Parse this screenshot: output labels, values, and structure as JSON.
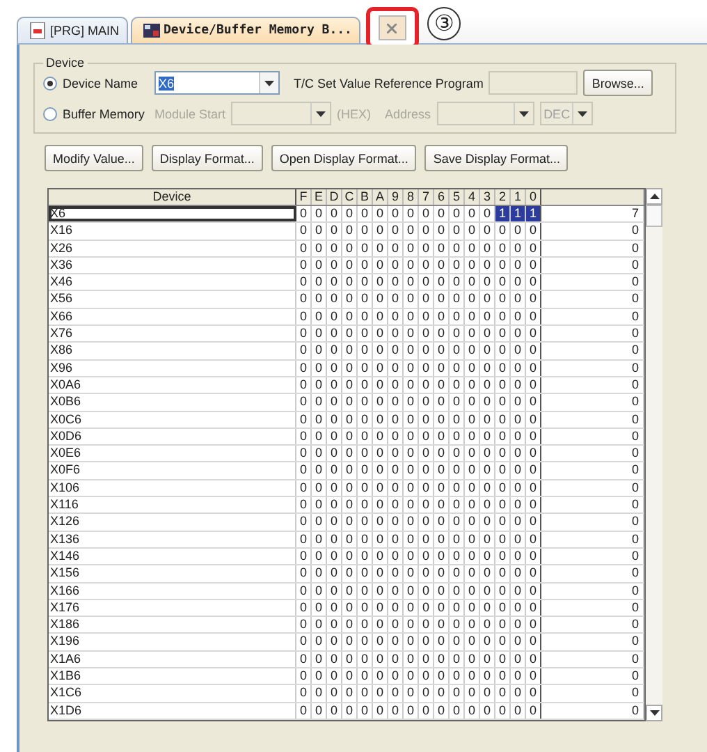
{
  "tabs": [
    {
      "label": "[PRG] MAIN",
      "selected": false
    },
    {
      "label": "Device/Buffer Memory B...",
      "selected": true
    }
  ],
  "callout": "③",
  "device_group": {
    "legend": "Device",
    "device_name": {
      "label": "Device Name",
      "selected": true,
      "value": "X6"
    },
    "tc_label": "T/C Set Value Reference Program",
    "browse": "Browse...",
    "buffer_memory": {
      "label": "Buffer Memory",
      "selected": false,
      "module_start": "Module Start",
      "hex": "(HEX)",
      "address": "Address",
      "format": "DEC"
    }
  },
  "buttons": [
    "Modify Value...",
    "Display Format...",
    "Open Display Format...",
    "Save Display Format..."
  ],
  "table": {
    "columns": [
      "Device",
      "F",
      "E",
      "D",
      "C",
      "B",
      "A",
      "9",
      "8",
      "7",
      "6",
      "5",
      "4",
      "3",
      "2",
      "1",
      "0"
    ],
    "rows": [
      {
        "device": "X6",
        "selected": true,
        "bits": [
          "0",
          "0",
          "0",
          "0",
          "0",
          "0",
          "0",
          "0",
          "0",
          "0",
          "0",
          "0",
          "0",
          "1",
          "1",
          "1"
        ],
        "on": [
          false,
          false,
          false,
          false,
          false,
          false,
          false,
          false,
          false,
          false,
          false,
          false,
          false,
          true,
          true,
          true
        ],
        "value": "7"
      },
      {
        "device": "X16",
        "selected": false,
        "bits": [
          "0",
          "0",
          "0",
          "0",
          "0",
          "0",
          "0",
          "0",
          "0",
          "0",
          "0",
          "0",
          "0",
          "0",
          "0",
          "0"
        ],
        "on": [
          false,
          false,
          false,
          false,
          false,
          false,
          false,
          false,
          false,
          false,
          false,
          false,
          false,
          false,
          false,
          false
        ],
        "value": "0"
      },
      {
        "device": "X26",
        "selected": false,
        "bits": [
          "0",
          "0",
          "0",
          "0",
          "0",
          "0",
          "0",
          "0",
          "0",
          "0",
          "0",
          "0",
          "0",
          "0",
          "0",
          "0"
        ],
        "on": [
          false,
          false,
          false,
          false,
          false,
          false,
          false,
          false,
          false,
          false,
          false,
          false,
          false,
          false,
          false,
          false
        ],
        "value": "0"
      },
      {
        "device": "X36",
        "selected": false,
        "bits": [
          "0",
          "0",
          "0",
          "0",
          "0",
          "0",
          "0",
          "0",
          "0",
          "0",
          "0",
          "0",
          "0",
          "0",
          "0",
          "0"
        ],
        "on": [
          false,
          false,
          false,
          false,
          false,
          false,
          false,
          false,
          false,
          false,
          false,
          false,
          false,
          false,
          false,
          false
        ],
        "value": "0"
      },
      {
        "device": "X46",
        "selected": false,
        "bits": [
          "0",
          "0",
          "0",
          "0",
          "0",
          "0",
          "0",
          "0",
          "0",
          "0",
          "0",
          "0",
          "0",
          "0",
          "0",
          "0"
        ],
        "on": [
          false,
          false,
          false,
          false,
          false,
          false,
          false,
          false,
          false,
          false,
          false,
          false,
          false,
          false,
          false,
          false
        ],
        "value": "0"
      },
      {
        "device": "X56",
        "selected": false,
        "bits": [
          "0",
          "0",
          "0",
          "0",
          "0",
          "0",
          "0",
          "0",
          "0",
          "0",
          "0",
          "0",
          "0",
          "0",
          "0",
          "0"
        ],
        "on": [
          false,
          false,
          false,
          false,
          false,
          false,
          false,
          false,
          false,
          false,
          false,
          false,
          false,
          false,
          false,
          false
        ],
        "value": "0"
      },
      {
        "device": "X66",
        "selected": false,
        "bits": [
          "0",
          "0",
          "0",
          "0",
          "0",
          "0",
          "0",
          "0",
          "0",
          "0",
          "0",
          "0",
          "0",
          "0",
          "0",
          "0"
        ],
        "on": [
          false,
          false,
          false,
          false,
          false,
          false,
          false,
          false,
          false,
          false,
          false,
          false,
          false,
          false,
          false,
          false
        ],
        "value": "0"
      },
      {
        "device": "X76",
        "selected": false,
        "bits": [
          "0",
          "0",
          "0",
          "0",
          "0",
          "0",
          "0",
          "0",
          "0",
          "0",
          "0",
          "0",
          "0",
          "0",
          "0",
          "0"
        ],
        "on": [
          false,
          false,
          false,
          false,
          false,
          false,
          false,
          false,
          false,
          false,
          false,
          false,
          false,
          false,
          false,
          false
        ],
        "value": "0"
      },
      {
        "device": "X86",
        "selected": false,
        "bits": [
          "0",
          "0",
          "0",
          "0",
          "0",
          "0",
          "0",
          "0",
          "0",
          "0",
          "0",
          "0",
          "0",
          "0",
          "0",
          "0"
        ],
        "on": [
          false,
          false,
          false,
          false,
          false,
          false,
          false,
          false,
          false,
          false,
          false,
          false,
          false,
          false,
          false,
          false
        ],
        "value": "0"
      },
      {
        "device": "X96",
        "selected": false,
        "bits": [
          "0",
          "0",
          "0",
          "0",
          "0",
          "0",
          "0",
          "0",
          "0",
          "0",
          "0",
          "0",
          "0",
          "0",
          "0",
          "0"
        ],
        "on": [
          false,
          false,
          false,
          false,
          false,
          false,
          false,
          false,
          false,
          false,
          false,
          false,
          false,
          false,
          false,
          false
        ],
        "value": "0"
      },
      {
        "device": "X0A6",
        "selected": false,
        "bits": [
          "0",
          "0",
          "0",
          "0",
          "0",
          "0",
          "0",
          "0",
          "0",
          "0",
          "0",
          "0",
          "0",
          "0",
          "0",
          "0"
        ],
        "on": [
          false,
          false,
          false,
          false,
          false,
          false,
          false,
          false,
          false,
          false,
          false,
          false,
          false,
          false,
          false,
          false
        ],
        "value": "0"
      },
      {
        "device": "X0B6",
        "selected": false,
        "bits": [
          "0",
          "0",
          "0",
          "0",
          "0",
          "0",
          "0",
          "0",
          "0",
          "0",
          "0",
          "0",
          "0",
          "0",
          "0",
          "0"
        ],
        "on": [
          false,
          false,
          false,
          false,
          false,
          false,
          false,
          false,
          false,
          false,
          false,
          false,
          false,
          false,
          false,
          false
        ],
        "value": "0"
      },
      {
        "device": "X0C6",
        "selected": false,
        "bits": [
          "0",
          "0",
          "0",
          "0",
          "0",
          "0",
          "0",
          "0",
          "0",
          "0",
          "0",
          "0",
          "0",
          "0",
          "0",
          "0"
        ],
        "on": [
          false,
          false,
          false,
          false,
          false,
          false,
          false,
          false,
          false,
          false,
          false,
          false,
          false,
          false,
          false,
          false
        ],
        "value": "0"
      },
      {
        "device": "X0D6",
        "selected": false,
        "bits": [
          "0",
          "0",
          "0",
          "0",
          "0",
          "0",
          "0",
          "0",
          "0",
          "0",
          "0",
          "0",
          "0",
          "0",
          "0",
          "0"
        ],
        "on": [
          false,
          false,
          false,
          false,
          false,
          false,
          false,
          false,
          false,
          false,
          false,
          false,
          false,
          false,
          false,
          false
        ],
        "value": "0"
      },
      {
        "device": "X0E6",
        "selected": false,
        "bits": [
          "0",
          "0",
          "0",
          "0",
          "0",
          "0",
          "0",
          "0",
          "0",
          "0",
          "0",
          "0",
          "0",
          "0",
          "0",
          "0"
        ],
        "on": [
          false,
          false,
          false,
          false,
          false,
          false,
          false,
          false,
          false,
          false,
          false,
          false,
          false,
          false,
          false,
          false
        ],
        "value": "0"
      },
      {
        "device": "X0F6",
        "selected": false,
        "bits": [
          "0",
          "0",
          "0",
          "0",
          "0",
          "0",
          "0",
          "0",
          "0",
          "0",
          "0",
          "0",
          "0",
          "0",
          "0",
          "0"
        ],
        "on": [
          false,
          false,
          false,
          false,
          false,
          false,
          false,
          false,
          false,
          false,
          false,
          false,
          false,
          false,
          false,
          false
        ],
        "value": "0"
      },
      {
        "device": "X106",
        "selected": false,
        "bits": [
          "0",
          "0",
          "0",
          "0",
          "0",
          "0",
          "0",
          "0",
          "0",
          "0",
          "0",
          "0",
          "0",
          "0",
          "0",
          "0"
        ],
        "on": [
          false,
          false,
          false,
          false,
          false,
          false,
          false,
          false,
          false,
          false,
          false,
          false,
          false,
          false,
          false,
          false
        ],
        "value": "0"
      },
      {
        "device": "X116",
        "selected": false,
        "bits": [
          "0",
          "0",
          "0",
          "0",
          "0",
          "0",
          "0",
          "0",
          "0",
          "0",
          "0",
          "0",
          "0",
          "0",
          "0",
          "0"
        ],
        "on": [
          false,
          false,
          false,
          false,
          false,
          false,
          false,
          false,
          false,
          false,
          false,
          false,
          false,
          false,
          false,
          false
        ],
        "value": "0"
      },
      {
        "device": "X126",
        "selected": false,
        "bits": [
          "0",
          "0",
          "0",
          "0",
          "0",
          "0",
          "0",
          "0",
          "0",
          "0",
          "0",
          "0",
          "0",
          "0",
          "0",
          "0"
        ],
        "on": [
          false,
          false,
          false,
          false,
          false,
          false,
          false,
          false,
          false,
          false,
          false,
          false,
          false,
          false,
          false,
          false
        ],
        "value": "0"
      },
      {
        "device": "X136",
        "selected": false,
        "bits": [
          "0",
          "0",
          "0",
          "0",
          "0",
          "0",
          "0",
          "0",
          "0",
          "0",
          "0",
          "0",
          "0",
          "0",
          "0",
          "0"
        ],
        "on": [
          false,
          false,
          false,
          false,
          false,
          false,
          false,
          false,
          false,
          false,
          false,
          false,
          false,
          false,
          false,
          false
        ],
        "value": "0"
      },
      {
        "device": "X146",
        "selected": false,
        "bits": [
          "0",
          "0",
          "0",
          "0",
          "0",
          "0",
          "0",
          "0",
          "0",
          "0",
          "0",
          "0",
          "0",
          "0",
          "0",
          "0"
        ],
        "on": [
          false,
          false,
          false,
          false,
          false,
          false,
          false,
          false,
          false,
          false,
          false,
          false,
          false,
          false,
          false,
          false
        ],
        "value": "0"
      },
      {
        "device": "X156",
        "selected": false,
        "bits": [
          "0",
          "0",
          "0",
          "0",
          "0",
          "0",
          "0",
          "0",
          "0",
          "0",
          "0",
          "0",
          "0",
          "0",
          "0",
          "0"
        ],
        "on": [
          false,
          false,
          false,
          false,
          false,
          false,
          false,
          false,
          false,
          false,
          false,
          false,
          false,
          false,
          false,
          false
        ],
        "value": "0"
      },
      {
        "device": "X166",
        "selected": false,
        "bits": [
          "0",
          "0",
          "0",
          "0",
          "0",
          "0",
          "0",
          "0",
          "0",
          "0",
          "0",
          "0",
          "0",
          "0",
          "0",
          "0"
        ],
        "on": [
          false,
          false,
          false,
          false,
          false,
          false,
          false,
          false,
          false,
          false,
          false,
          false,
          false,
          false,
          false,
          false
        ],
        "value": "0"
      },
      {
        "device": "X176",
        "selected": false,
        "bits": [
          "0",
          "0",
          "0",
          "0",
          "0",
          "0",
          "0",
          "0",
          "0",
          "0",
          "0",
          "0",
          "0",
          "0",
          "0",
          "0"
        ],
        "on": [
          false,
          false,
          false,
          false,
          false,
          false,
          false,
          false,
          false,
          false,
          false,
          false,
          false,
          false,
          false,
          false
        ],
        "value": "0"
      },
      {
        "device": "X186",
        "selected": false,
        "bits": [
          "0",
          "0",
          "0",
          "0",
          "0",
          "0",
          "0",
          "0",
          "0",
          "0",
          "0",
          "0",
          "0",
          "0",
          "0",
          "0"
        ],
        "on": [
          false,
          false,
          false,
          false,
          false,
          false,
          false,
          false,
          false,
          false,
          false,
          false,
          false,
          false,
          false,
          false
        ],
        "value": "0"
      },
      {
        "device": "X196",
        "selected": false,
        "bits": [
          "0",
          "0",
          "0",
          "0",
          "0",
          "0",
          "0",
          "0",
          "0",
          "0",
          "0",
          "0",
          "0",
          "0",
          "0",
          "0"
        ],
        "on": [
          false,
          false,
          false,
          false,
          false,
          false,
          false,
          false,
          false,
          false,
          false,
          false,
          false,
          false,
          false,
          false
        ],
        "value": "0"
      },
      {
        "device": "X1A6",
        "selected": false,
        "bits": [
          "0",
          "0",
          "0",
          "0",
          "0",
          "0",
          "0",
          "0",
          "0",
          "0",
          "0",
          "0",
          "0",
          "0",
          "0",
          "0"
        ],
        "on": [
          false,
          false,
          false,
          false,
          false,
          false,
          false,
          false,
          false,
          false,
          false,
          false,
          false,
          false,
          false,
          false
        ],
        "value": "0"
      },
      {
        "device": "X1B6",
        "selected": false,
        "bits": [
          "0",
          "0",
          "0",
          "0",
          "0",
          "0",
          "0",
          "0",
          "0",
          "0",
          "0",
          "0",
          "0",
          "0",
          "0",
          "0"
        ],
        "on": [
          false,
          false,
          false,
          false,
          false,
          false,
          false,
          false,
          false,
          false,
          false,
          false,
          false,
          false,
          false,
          false
        ],
        "value": "0"
      },
      {
        "device": "X1C6",
        "selected": false,
        "bits": [
          "0",
          "0",
          "0",
          "0",
          "0",
          "0",
          "0",
          "0",
          "0",
          "0",
          "0",
          "0",
          "0",
          "0",
          "0",
          "0"
        ],
        "on": [
          false,
          false,
          false,
          false,
          false,
          false,
          false,
          false,
          false,
          false,
          false,
          false,
          false,
          false,
          false,
          false
        ],
        "value": "0"
      },
      {
        "device": "X1D6",
        "selected": false,
        "bits": [
          "0",
          "0",
          "0",
          "0",
          "0",
          "0",
          "0",
          "0",
          "0",
          "0",
          "0",
          "0",
          "0",
          "0",
          "0",
          "0"
        ],
        "on": [
          false,
          false,
          false,
          false,
          false,
          false,
          false,
          false,
          false,
          false,
          false,
          false,
          false,
          false,
          false,
          false
        ],
        "value": "0"
      }
    ]
  }
}
